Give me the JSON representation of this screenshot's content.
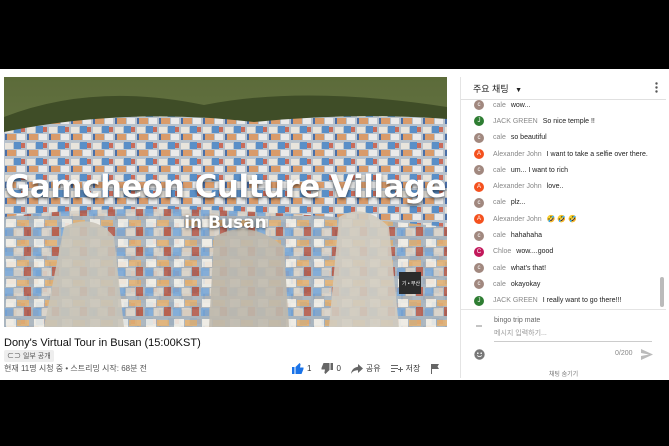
{
  "video": {
    "overlay_title": "Gamcheon Culture Village",
    "overlay_subtitle": "in Busan",
    "watermark": "기 • 부산"
  },
  "info": {
    "title": "Dony's Virtual Tour in Busan (15:00KST)",
    "badge": "일부 공개",
    "meta": "현재 11명 시청 중 • 스트리밍 시작: 68분 전",
    "like_count": "1",
    "dislike_count": "0",
    "share_label": "공유",
    "save_label": "저장"
  },
  "chat": {
    "header": "주요 채팅",
    "messages": [
      {
        "initial": "c",
        "color": "#a1887f",
        "author": "cale",
        "text": "wow..."
      },
      {
        "initial": "J",
        "color": "#2e7d32",
        "author": "JACK GREEN",
        "text": "So nice temple !!"
      },
      {
        "initial": "c",
        "color": "#a1887f",
        "author": "cale",
        "text": "so beautiful"
      },
      {
        "initial": "A",
        "color": "#f4511e",
        "author": "Alexander John",
        "text": "I want to take a selfie over there."
      },
      {
        "initial": "c",
        "color": "#a1887f",
        "author": "cale",
        "text": "um... I want to rich"
      },
      {
        "initial": "A",
        "color": "#f4511e",
        "author": "Alexander John",
        "text": "love.."
      },
      {
        "initial": "c",
        "color": "#a1887f",
        "author": "cale",
        "text": "plz..."
      },
      {
        "initial": "A",
        "color": "#f4511e",
        "author": "Alexander John",
        "text": "🤣 🤣 🤣"
      },
      {
        "initial": "c",
        "color": "#a1887f",
        "author": "cale",
        "text": "hahahaha"
      },
      {
        "initial": "C",
        "color": "#c2185b",
        "author": "Chloe",
        "text": "wow....good"
      },
      {
        "initial": "c",
        "color": "#a1887f",
        "author": "cale",
        "text": "what's that!"
      },
      {
        "initial": "c",
        "color": "#a1887f",
        "author": "cale",
        "text": "okayokay"
      },
      {
        "initial": "J",
        "color": "#2e7d32",
        "author": "JACK GREEN",
        "text": "I really want to go there!!!"
      }
    ],
    "user_name": "bingo trip mate",
    "placeholder": "메시지 입력하기...",
    "char_count": "0/200",
    "hide_chat": "채팅 숨기기"
  }
}
